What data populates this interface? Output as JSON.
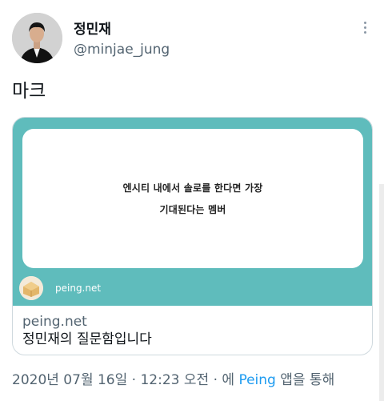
{
  "author": {
    "display_name": "정민재",
    "handle": "@minjae_jung"
  },
  "tweet": {
    "text": "마크"
  },
  "card": {
    "question_line1": "엔시티 내에서 솔로를 한다면 가장",
    "question_line2": "기대된다는 멤버",
    "site_label": "peing.net",
    "domain": "peing.net",
    "title": "정민재의 질문함입니다",
    "background_color": "#5fbcbc"
  },
  "timestamp": {
    "date": "2020년 07월 16일",
    "separator": "·",
    "time": "12:23 오전",
    "via_prefix": "· 에",
    "source": "Peing",
    "via_suffix": "앱을 통해"
  },
  "icons": {
    "more": "more-vertical-icon",
    "avatar": "avatar",
    "peing_logo": "peing-logo-icon"
  },
  "colors": {
    "link": "#1d9bf0",
    "secondary_text": "#536471",
    "primary_text": "#0f1419"
  }
}
